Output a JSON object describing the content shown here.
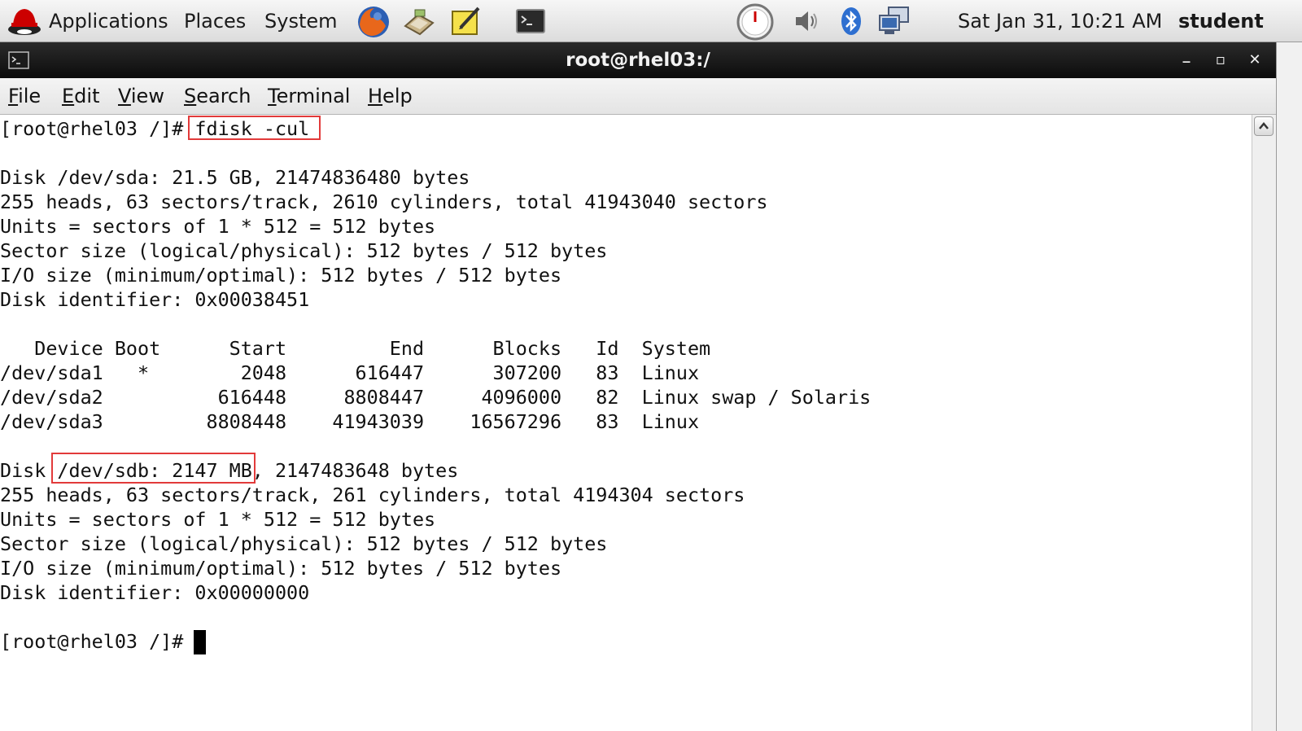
{
  "top_panel": {
    "menus": [
      "Applications",
      "Places",
      "System"
    ],
    "launchers": [
      "firefox-icon",
      "mail-icon",
      "notes-icon",
      "terminal-launcher-icon"
    ],
    "tray": [
      "network-speed-icon",
      "volume-icon",
      "bluetooth-icon",
      "network-icon"
    ],
    "clock": "Sat Jan 31, 10:21 AM",
    "user": "student"
  },
  "window": {
    "title": "root@rhel03:/",
    "controls": {
      "minimize": "_",
      "maximize": "▫",
      "close": "✕"
    }
  },
  "menubar": [
    "File",
    "Edit",
    "View",
    "Search",
    "Terminal",
    "Help"
  ],
  "terminal": {
    "lines": [
      "[root@rhel03 /]# fdisk -cul",
      "",
      "Disk /dev/sda: 21.5 GB, 21474836480 bytes",
      "255 heads, 63 sectors/track, 2610 cylinders, total 41943040 sectors",
      "Units = sectors of 1 * 512 = 512 bytes",
      "Sector size (logical/physical): 512 bytes / 512 bytes",
      "I/O size (minimum/optimal): 512 bytes / 512 bytes",
      "Disk identifier: 0x00038451",
      "",
      "   Device Boot      Start         End      Blocks   Id  System",
      "/dev/sda1   *        2048      616447      307200   83  Linux",
      "/dev/sda2          616448     8808447     4096000   82  Linux swap / Solaris",
      "/dev/sda3         8808448    41943039    16567296   83  Linux",
      "",
      "Disk /dev/sdb: 2147 MB, 2147483648 bytes",
      "255 heads, 63 sectors/track, 261 cylinders, total 4194304 sectors",
      "Units = sectors of 1 * 512 = 512 bytes",
      "Sector size (logical/physical): 512 bytes / 512 bytes",
      "I/O size (minimum/optimal): 512 bytes / 512 bytes",
      "Disk identifier: 0x00000000",
      "",
      "[root@rhel03 /]# "
    ],
    "highlights": [
      "fdisk -cul",
      "/dev/sdb: 2147 MB"
    ]
  },
  "colors": {
    "highlight_box": "#e23a3a",
    "titlebar": "#111111",
    "terminal_bg": "#ffffff",
    "terminal_fg": "#111111"
  }
}
